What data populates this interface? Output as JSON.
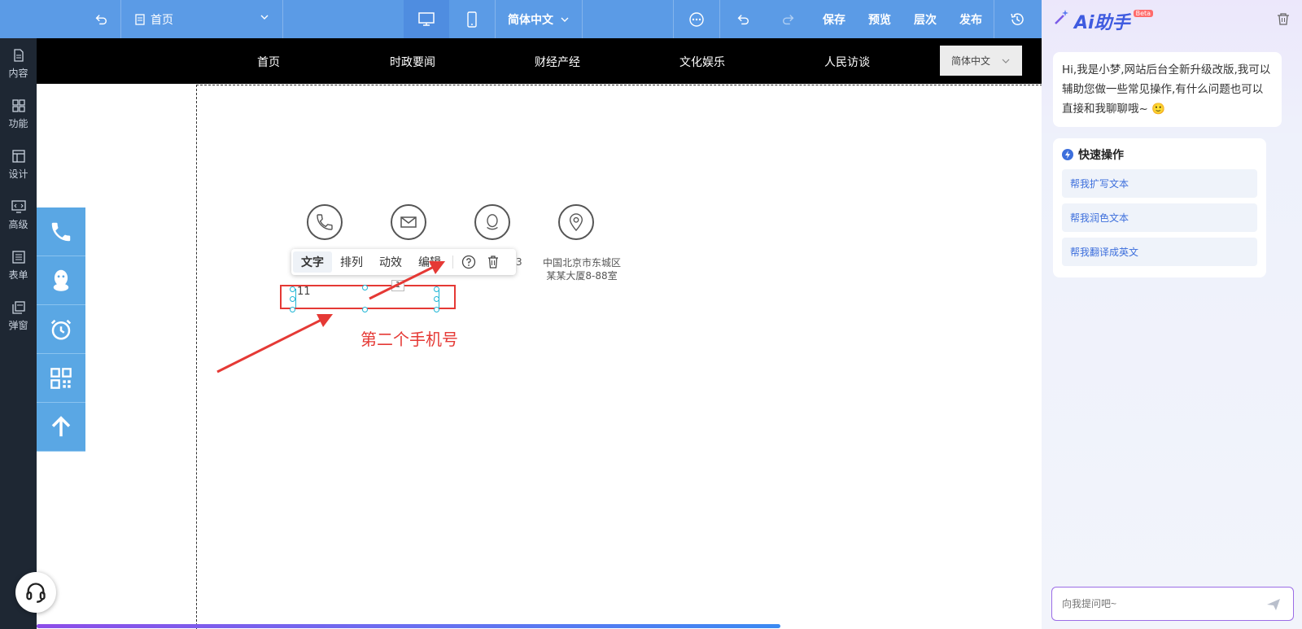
{
  "toolbar": {
    "page_name": "首页",
    "language": "简体中文",
    "save": "保存",
    "preview": "预览",
    "layers": "层次",
    "publish": "发布"
  },
  "sidebar": {
    "items": [
      {
        "label": "内容",
        "icon": "content-icon"
      },
      {
        "label": "功能",
        "icon": "grid-icon"
      },
      {
        "label": "设计",
        "icon": "layout-icon"
      },
      {
        "label": "高级",
        "icon": "code-icon"
      },
      {
        "label": "表单",
        "icon": "form-icon"
      },
      {
        "label": "弹窗",
        "icon": "popup-icon"
      }
    ]
  },
  "site": {
    "nav": [
      "首页",
      "时政要闻",
      "财经产经",
      "文化娱乐",
      "人民访谈"
    ],
    "language": "简体中文",
    "address": [
      "中国北京市东城区",
      "某某大厦8-88室"
    ],
    "address_partial": "3",
    "selected_text": "11",
    "tag_number": "1"
  },
  "mini_toolbar": {
    "text": "文字",
    "arrange": "排列",
    "animation": "动效",
    "edit": "编辑"
  },
  "annotation": {
    "label": "第二个手机号",
    "color": "#e53935"
  },
  "progress": 0.74,
  "ai": {
    "title": "Ai助手",
    "badge": "Beta",
    "greeting": "Hi,我是小梦,网站后台全新升级改版,我可以辅助您做一些常见操作,有什么问题也可以直接和我聊聊哦~",
    "quick_title": "快速操作",
    "quick_actions": [
      "帮我扩写文本",
      "帮我润色文本",
      "帮我翻译成英文"
    ],
    "input_placeholder": "向我提问吧~"
  }
}
